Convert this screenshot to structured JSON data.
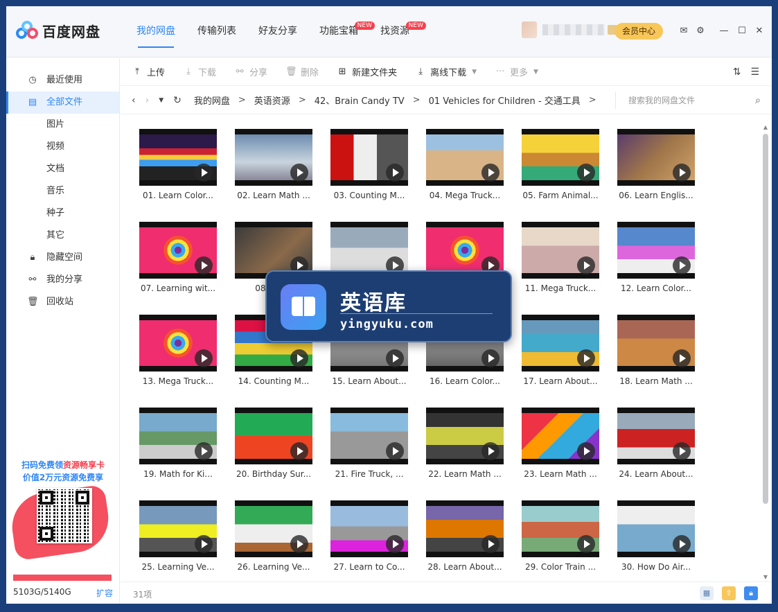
{
  "app": {
    "name": "百度网盘",
    "colors": {
      "accent": "#2f86f6",
      "vip": "#f8c75a",
      "badge": "#f5414e",
      "desktop": "#1b3f7a"
    }
  },
  "nav": [
    {
      "label": "我的网盘",
      "active": true
    },
    {
      "label": "传输列表"
    },
    {
      "label": "好友分享"
    },
    {
      "label": "功能宝箱",
      "badge": "NEW"
    },
    {
      "label": "找资源",
      "badge": "NEW"
    }
  ],
  "header": {
    "vip_label": "会员中心",
    "icons": [
      "mail-icon",
      "settings-icon",
      "minimize-icon",
      "maximize-icon",
      "close-icon"
    ]
  },
  "sidebar": {
    "items": [
      {
        "label": "最近使用",
        "icon": "clock-icon"
      },
      {
        "label": "全部文件",
        "icon": "file-icon",
        "active": true
      },
      {
        "label": "图片"
      },
      {
        "label": "视频"
      },
      {
        "label": "文档"
      },
      {
        "label": "音乐"
      },
      {
        "label": "种子"
      },
      {
        "label": "其它"
      },
      {
        "label": "隐藏空间",
        "icon": "lock-icon"
      },
      {
        "label": "我的分享",
        "icon": "share-icon"
      },
      {
        "label": "回收站",
        "icon": "trash-icon"
      }
    ],
    "promo": {
      "line1_a": "扫码免费领",
      "line1_b": "资源畅享卡",
      "line2": "价值2万元资源免费享"
    },
    "storage": {
      "text": "5103G/5140G",
      "used_fraction": 0.993,
      "expand": "扩容"
    }
  },
  "toolbar": {
    "upload": "上传",
    "download": "下载",
    "share": "分享",
    "delete": "删除",
    "new_folder": "新建文件夹",
    "offline_download": "离线下载",
    "more": "更多"
  },
  "breadcrumb": {
    "items": [
      "我的网盘",
      "英语资源",
      "42、Brain Candy TV",
      "01 Vehicles for Children - 交通工具"
    ],
    "separator": ">",
    "search_placeholder": "搜索我的网盘文件"
  },
  "files": [
    "01. Learn Color...",
    "02. Learn Math ...",
    "03. Counting M...",
    "04. Mega Truck...",
    "05. Farm Animal...",
    "06. Learn Englis...",
    "07. Learning wit...",
    "08. Alp...",
    "09. ...",
    "10. ...",
    "11. Mega Truck...",
    "12. Learn Color...",
    "13. Mega Truck...",
    "14. Counting M...",
    "15. Learn About...",
    "16. Learn Color...",
    "17. Learn About...",
    "18. Learn Math ...",
    "19. Math for Ki...",
    "20. Birthday Sur...",
    "21. Fire Truck, ...",
    "22. Learn Math ...",
    "23. Learn Math ...",
    "24. Learn About...",
    "25. Learning Ve...",
    "26. Learning Ve...",
    "27. Learn to Co...",
    "28. Learn About...",
    "29. Color Train ...",
    "30. How Do Air..."
  ],
  "status": {
    "count": "31项"
  },
  "watermark": {
    "title": "英语库",
    "url": "yingyuku.com"
  }
}
